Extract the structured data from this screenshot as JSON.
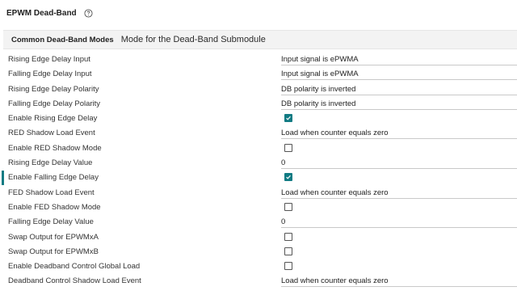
{
  "header": {
    "title": "EPWM Dead-Band",
    "help_icon": "question-circle-icon"
  },
  "section": {
    "title": "Common Dead-Band Modes",
    "description": "Mode for the Dead-Band Submodule"
  },
  "accent_color": "#117b83",
  "rows": [
    {
      "label": "Rising Edge Delay Input",
      "type": "field",
      "value": "Input signal is ePWMA"
    },
    {
      "label": "Falling Edge Delay Input",
      "type": "field",
      "value": "Input signal is ePWMA"
    },
    {
      "label": "Rising Edge Delay Polarity",
      "type": "field",
      "value": "DB polarity is inverted"
    },
    {
      "label": "Falling Edge Delay Polarity",
      "type": "field",
      "value": "DB polarity is inverted"
    },
    {
      "label": "Enable Rising Edge Delay",
      "type": "checkbox",
      "checked": true
    },
    {
      "label": "RED Shadow Load Event",
      "type": "field",
      "value": "Load when counter equals zero"
    },
    {
      "label": "Enable RED Shadow Mode",
      "type": "checkbox",
      "checked": false
    },
    {
      "label": "Rising Edge Delay Value",
      "type": "field",
      "value": "0"
    },
    {
      "label": "Enable Falling Edge Delay",
      "type": "checkbox",
      "checked": true,
      "active": true
    },
    {
      "label": "FED Shadow Load Event",
      "type": "field",
      "value": "Load when counter equals zero"
    },
    {
      "label": "Enable FED Shadow Mode",
      "type": "checkbox",
      "checked": false
    },
    {
      "label": "Falling Edge Delay Value",
      "type": "field",
      "value": "0"
    },
    {
      "label": "Swap Output for EPWMxA",
      "type": "checkbox",
      "checked": false
    },
    {
      "label": "Swap Output for EPWMxB",
      "type": "checkbox",
      "checked": false
    },
    {
      "label": "Enable Deadband Control Global Load",
      "type": "checkbox",
      "checked": false
    },
    {
      "label": "Deadband Control Shadow Load Event",
      "type": "field",
      "value": "Load when counter equals zero"
    }
  ]
}
